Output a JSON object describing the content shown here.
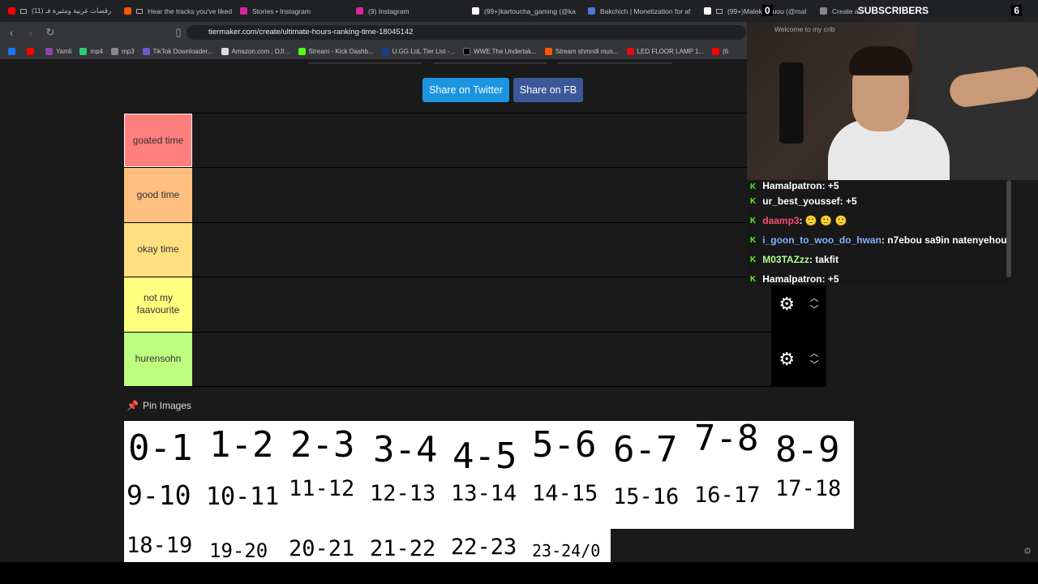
{
  "tabs": [
    {
      "title": "(11) رقصات غربية ومثيرة فـ",
      "color": "#ff0000"
    },
    {
      "title": "Hear the tracks you've liked",
      "color": "#ff5500"
    },
    {
      "title": "Stories • Instagram",
      "color": "#d6249f"
    },
    {
      "title": "(9) Instagram",
      "color": "#d6249f"
    },
    {
      "title": "(99+)kartoucha_gaming (@ka",
      "color": "#ffffff"
    },
    {
      "title": "Bakchich | Monetization for af",
      "color": "#4a7bd0"
    },
    {
      "title": "(99+)Malek Kouou (@mal",
      "color": "#ffffff"
    },
    {
      "title": "Create a",
      "color": "#888888"
    }
  ],
  "address": {
    "url": "tiermaker.com/create/ultimate-hours-ranking-time-18045142"
  },
  "bookmarks": [
    {
      "label": "",
      "color": "#1877f2"
    },
    {
      "label": "",
      "color": "#ff0000"
    },
    {
      "label": "Yamli",
      "color": "#8e44ad"
    },
    {
      "label": "mp4",
      "color": "#2ecc71"
    },
    {
      "label": "mp3",
      "color": "#888888"
    },
    {
      "label": "TikTok Downloader...",
      "color": "#6a5acd"
    },
    {
      "label": "Amazon.com : DJI...",
      "color": "#dddddd"
    },
    {
      "label": "Stream - Kick Dashb...",
      "color": "#53fc18"
    },
    {
      "label": "U.GG LoL Tier List -...",
      "color": "#1e3a8a"
    },
    {
      "label": "WWE The Undertak...",
      "color": "#000000"
    },
    {
      "label": "Stream shmndl mus...",
      "color": "#ff5500"
    },
    {
      "label": "LED FLOOR LAMP 1...",
      "color": "#e50914"
    },
    {
      "label": "(6",
      "color": "#ff0000"
    }
  ],
  "share": {
    "twitter": "Share on Twitter",
    "fb": "Share on FB"
  },
  "tiers": [
    {
      "label": "goated time",
      "color": "#ff7f7f"
    },
    {
      "label": "good time",
      "color": "#ffbf7f"
    },
    {
      "label": "okay time",
      "color": "#ffdf7f"
    },
    {
      "label": "not my faavourite",
      "color": "#ffff7f"
    },
    {
      "label": "hurensohn",
      "color": "#bfff7f"
    }
  ],
  "pin": {
    "label": "Pin Images"
  },
  "images_row1": [
    "0-1",
    "1-2",
    "2-3",
    "3-4",
    "4-5",
    "5-6",
    "6-7",
    "7-8",
    "8-9"
  ],
  "images_row2": [
    "9-10",
    "10-11",
    "11-12",
    "12-13",
    "13-14",
    "14-15",
    "15-16",
    "16-17",
    "17-18"
  ],
  "images_row3": [
    "18-19",
    "19-20",
    "20-21",
    "21-22",
    "22-23",
    "23-24/0"
  ],
  "overlay": {
    "subs_left": "0",
    "subs_label": "SUBSCRIBERS",
    "subs_right": "6",
    "webcam_sign": "Welcome to my crib"
  },
  "chat": [
    {
      "user": "Hamalpatron",
      "text": " : +5",
      "color": "#ffffff"
    },
    {
      "user": "ur_best_youssef",
      "text": " : +5",
      "color": "#ffffff"
    },
    {
      "user": "daamp3",
      "text": " : 🙂 🙂 🙂",
      "color": "#ff4d6d"
    },
    {
      "user": "i_goon_to_woo_do_hwan",
      "text": " : n7ebou sa9in natenyehou",
      "color": "#7fb3ff"
    },
    {
      "user": "M03TAZzz",
      "text": " : takfit",
      "color": "#adff8f"
    },
    {
      "user": "Hamalpatron",
      "text": " : +5",
      "color": "#ffffff"
    }
  ]
}
